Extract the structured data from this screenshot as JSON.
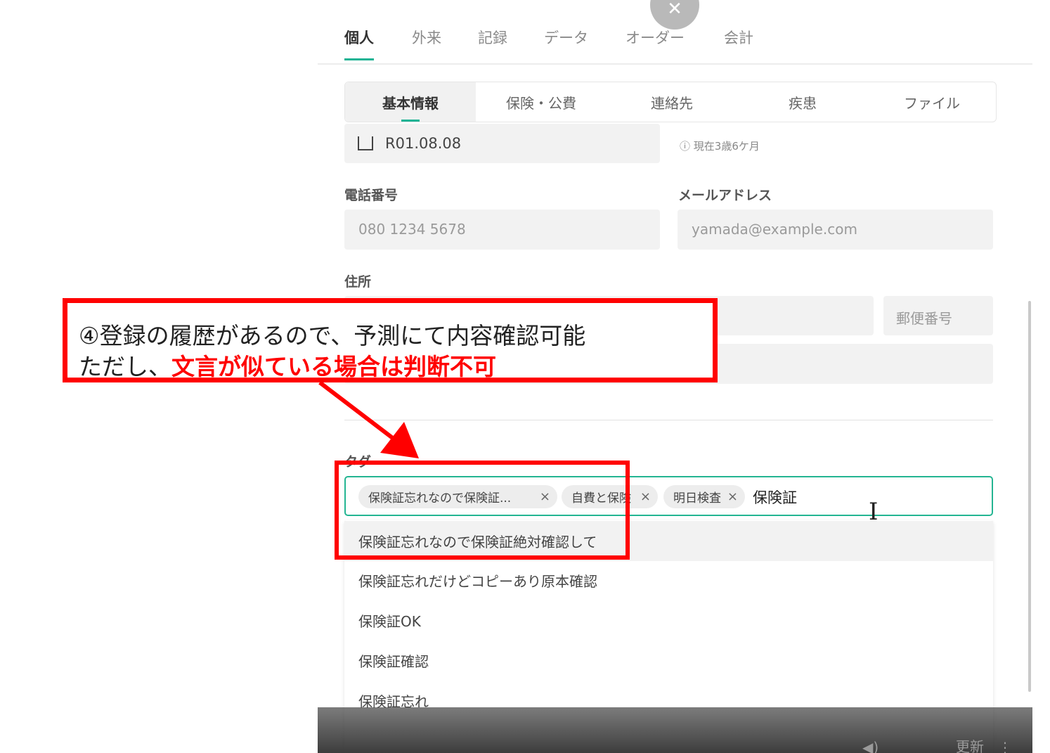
{
  "main_tabs": [
    "個人",
    "外来",
    "記録",
    "データ",
    "オーダー",
    "会計"
  ],
  "sub_tabs": [
    "基本情報",
    "保険・公費",
    "連絡先",
    "疾患",
    "ファイル"
  ],
  "birthdate": {
    "value": "R01.08.08",
    "age_note": "現在3歳6ケ月"
  },
  "phone": {
    "label": "電話番号",
    "placeholder": "080 1234 5678"
  },
  "email": {
    "label": "メールアドレス",
    "placeholder": "yamada@example.com"
  },
  "address": {
    "label": "住所",
    "postal_placeholder": "郵便番号"
  },
  "tags": {
    "label": "タグ",
    "chips": [
      "保険証忘れなので保険証...",
      "自費と保険",
      "明日検査"
    ],
    "typed": "保険証",
    "chip_close": "×"
  },
  "suggestions": [
    "保険証忘れなので保険証絶対確認して",
    "保険証忘れだけどコピーあり原本確認",
    "保険証OK",
    "保険証確認",
    "保険証忘れ"
  ],
  "bottom_bar": {
    "update_label": "更新"
  },
  "annotation": {
    "line1": "④登録の履歴があるので、予測にて内容確認可能",
    "line2_prefix": "ただし、",
    "line2_emphasis": "文言が似ている場合は判断不可"
  },
  "colors": {
    "accent": "#1cb394",
    "annotation_red": "#ff0000"
  },
  "icons": {
    "close": "close-icon",
    "cursor": "text-cursor-icon",
    "volume": "volume-icon",
    "more": "more-vertical-icon"
  }
}
